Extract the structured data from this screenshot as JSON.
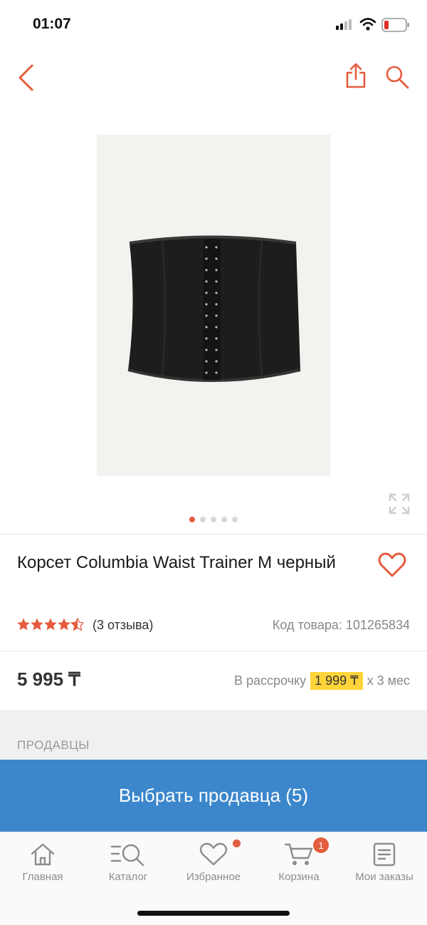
{
  "status_bar": {
    "time": "01:07"
  },
  "colors": {
    "accent": "#e55b3d",
    "primary_button": "#3c87cc",
    "installment_highlight": "#ffd43a"
  },
  "nav": {
    "back_icon": "chevron-left-icon",
    "share_icon": "share-icon",
    "search_icon": "search-icon"
  },
  "gallery": {
    "pages": 5,
    "current_page": 1,
    "expand_icon": "expand-icon"
  },
  "product": {
    "title": "Корсет Columbia Waist Trainer M черный",
    "rating": 4.5,
    "reviews": "(3 отзыва)",
    "sku": "Код товара: 101265834",
    "price": "5 995 ₸",
    "installment_prefix": "В рассрочку",
    "installment_amount": "1 999 ₸",
    "installment_suffix": "x 3 мес"
  },
  "sellers": {
    "label": "ПРОДАВЦЫ",
    "choose_button": "Выбрать продавца (5)"
  },
  "tabbar": {
    "items": [
      {
        "label": "Главная",
        "icon": "home-icon"
      },
      {
        "label": "Каталог",
        "icon": "catalog-icon"
      },
      {
        "label": "Избранное",
        "icon": "heart-icon"
      },
      {
        "label": "Корзина",
        "icon": "cart-icon",
        "badge": "1"
      },
      {
        "label": "Мои заказы",
        "icon": "orders-icon"
      }
    ]
  }
}
